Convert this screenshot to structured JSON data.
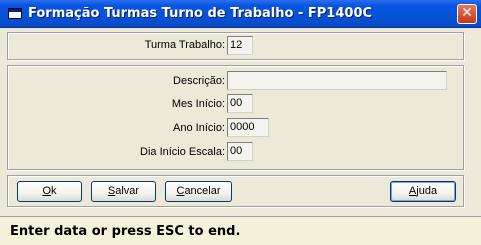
{
  "window": {
    "title": "Formação Turmas Turno de Trabalho - FP1400C",
    "close_glyph": "✕"
  },
  "header_group": {
    "turma_trabalho": {
      "label": "Turma Trabalho:",
      "value": "12"
    }
  },
  "details_group": {
    "descricao": {
      "label": "Descrição:",
      "value": ""
    },
    "mes_inicio": {
      "label": "Mes Início:",
      "value": "00"
    },
    "ano_inicio": {
      "label": "Ano Início:",
      "value": "0000"
    },
    "dia_inicio_escala": {
      "label": "Dia Início Escala:",
      "value": "00"
    }
  },
  "buttons": {
    "ok": {
      "hotkey": "O",
      "rest": "k"
    },
    "salvar": {
      "hotkey": "S",
      "rest": "alvar"
    },
    "cancelar": {
      "hotkey": "C",
      "rest": "ancelar"
    },
    "ajuda": {
      "hotkey": "A",
      "rest": "juda"
    }
  },
  "status": {
    "text": "Enter data or press ESC to end."
  },
  "icons": {
    "window_icon": "window-icon",
    "close": "close-icon"
  }
}
